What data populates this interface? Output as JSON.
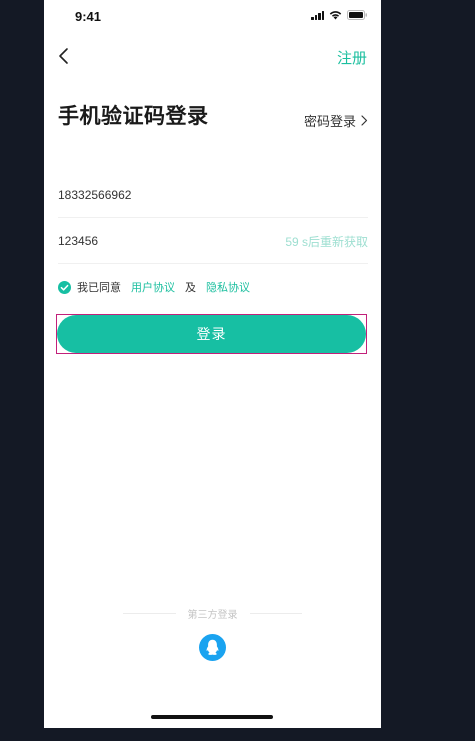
{
  "status_bar": {
    "time": "9:41"
  },
  "nav": {
    "back_icon": "chevron-left-icon",
    "register_label": "注册"
  },
  "title": "手机验证码登录",
  "password_login_label": "密码登录",
  "form": {
    "phone_value": "18332566962",
    "code_value": "123456",
    "resend_label": "59 s后重新获取"
  },
  "agreement": {
    "checked": true,
    "prefix": "我已同意",
    "user_agreement": "用户协议",
    "conjunction": "及",
    "privacy_policy": "隐私协议"
  },
  "login_button_label": "登录",
  "third_party": {
    "label": "第三方登录",
    "providers": [
      "qq-icon"
    ]
  },
  "colors": {
    "accent": "#17bfa3",
    "background": "#141925",
    "resend_text": "#9edfd1"
  }
}
